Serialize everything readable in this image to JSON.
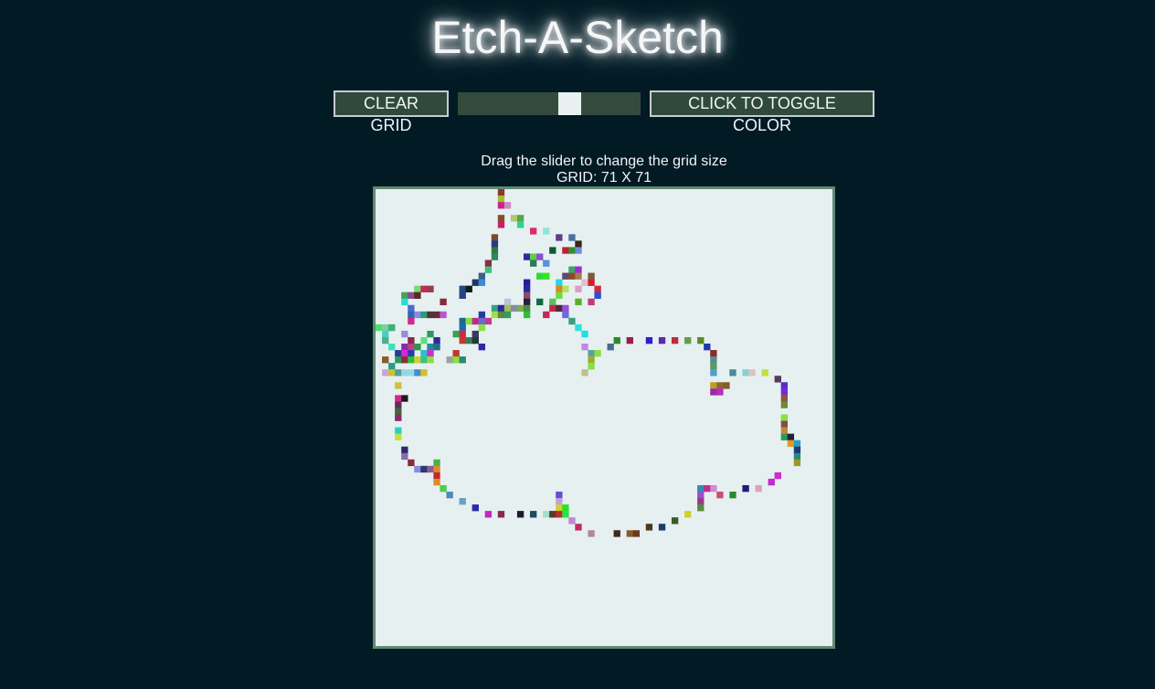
{
  "app": {
    "title": "Etch-A-Sketch"
  },
  "controls": {
    "clear_label": "CLEAR GRID",
    "toggle_label": "CLICK TO TOGGLE COLOR",
    "slider_value_fraction": 0.63
  },
  "info": {
    "hint": "Drag the slider to change the grid size",
    "grid_size": "GRID: 71 X 71"
  },
  "grid": {
    "columns": 71,
    "rows": 71,
    "background": "#e7f0f1",
    "painted_cells": [
      [
        19,
        0,
        "#8e3a2a"
      ],
      [
        19,
        1,
        "#a1c22d"
      ],
      [
        19,
        2,
        "#cc2287"
      ],
      [
        20,
        2,
        "#c88fc0"
      ],
      [
        19,
        4,
        "#8a4b2b"
      ],
      [
        21,
        4,
        "#b2c772"
      ],
      [
        22,
        4,
        "#5aa646"
      ],
      [
        19,
        5,
        "#cd1e6c"
      ],
      [
        22,
        5,
        "#2dd68d"
      ],
      [
        24,
        6,
        "#d8306e"
      ],
      [
        26,
        6,
        "#8fe6d6"
      ],
      [
        18,
        7,
        "#7a4a2c"
      ],
      [
        28,
        7,
        "#5e3f8a"
      ],
      [
        30,
        7,
        "#4f6fa1"
      ],
      [
        18,
        8,
        "#2a3a8a"
      ],
      [
        31,
        8,
        "#3c2514"
      ],
      [
        18,
        9,
        "#2c7a42"
      ],
      [
        27,
        9,
        "#0e5a2e"
      ],
      [
        29,
        9,
        "#c21d3c"
      ],
      [
        30,
        9,
        "#30902a"
      ],
      [
        31,
        9,
        "#6b8ad8"
      ],
      [
        18,
        10,
        "#2b8a55"
      ],
      [
        23,
        10,
        "#2d2aa3"
      ],
      [
        24,
        10,
        "#5fce4a"
      ],
      [
        25,
        10,
        "#8a4ed2"
      ],
      [
        17,
        11,
        "#8a2b47"
      ],
      [
        24,
        11,
        "#2e7a51"
      ],
      [
        26,
        11,
        "#5b8fe0"
      ],
      [
        17,
        12,
        "#3cbf7a"
      ],
      [
        30,
        12,
        "#3ca56b"
      ],
      [
        31,
        12,
        "#9a2bd8"
      ],
      [
        16,
        13,
        "#3a5f8a"
      ],
      [
        25,
        13,
        "#2ddb33"
      ],
      [
        26,
        13,
        "#33e51e"
      ],
      [
        29,
        13,
        "#5a4a6a"
      ],
      [
        30,
        13,
        "#8a4a2a"
      ],
      [
        31,
        13,
        "#a87a4e"
      ],
      [
        33,
        13,
        "#7a5a3b"
      ],
      [
        15,
        14,
        "#1e3a5f"
      ],
      [
        16,
        14,
        "#3a8ad2"
      ],
      [
        23,
        14,
        "#2a1a9a"
      ],
      [
        28,
        14,
        "#2ad6e3"
      ],
      [
        32,
        14,
        "#e0c0d0"
      ],
      [
        33,
        14,
        "#d21e2e"
      ],
      [
        6,
        15,
        "#6fe070"
      ],
      [
        7,
        15,
        "#c22a5a"
      ],
      [
        8,
        15,
        "#9a3b4a"
      ],
      [
        13,
        15,
        "#1f4a7a"
      ],
      [
        14,
        15,
        "#0e1a1e"
      ],
      [
        23,
        15,
        "#262a9a"
      ],
      [
        28,
        15,
        "#d68a1e"
      ],
      [
        29,
        15,
        "#b8e060"
      ],
      [
        31,
        15,
        "#d6a0c8"
      ],
      [
        34,
        15,
        "#d2283a"
      ],
      [
        4,
        16,
        "#4aa05a"
      ],
      [
        5,
        16,
        "#8a4e8e"
      ],
      [
        6,
        16,
        "#5a2a2a"
      ],
      [
        13,
        16,
        "#2a3e8a"
      ],
      [
        23,
        16,
        "#8a4e6a"
      ],
      [
        28,
        16,
        "#6adf3a"
      ],
      [
        34,
        16,
        "#2b4fd0"
      ],
      [
        4,
        17,
        "#1ee0d0"
      ],
      [
        10,
        17,
        "#8a2a3a"
      ],
      [
        20,
        17,
        "#c2c0d6"
      ],
      [
        23,
        17,
        "#2a1e3a"
      ],
      [
        25,
        17,
        "#0e6a3e"
      ],
      [
        27,
        17,
        "#5ac060"
      ],
      [
        31,
        17,
        "#5ab02a"
      ],
      [
        33,
        17,
        "#c23a7a"
      ],
      [
        5,
        18,
        "#4a6ad8"
      ],
      [
        18,
        18,
        "#3aa080"
      ],
      [
        19,
        18,
        "#2a2a9a"
      ],
      [
        20,
        18,
        "#a0c060"
      ],
      [
        21,
        18,
        "#8a8aa0"
      ],
      [
        22,
        18,
        "#7ab050"
      ],
      [
        23,
        18,
        "#4a8a4a"
      ],
      [
        27,
        18,
        "#c22a4a"
      ],
      [
        28,
        18,
        "#4a2a3a"
      ],
      [
        29,
        18,
        "#9a4ed0"
      ],
      [
        5,
        19,
        "#2a6aaa"
      ],
      [
        6,
        19,
        "#8a8ae0"
      ],
      [
        7,
        19,
        "#2a9a7a"
      ],
      [
        8,
        19,
        "#4a3a2a"
      ],
      [
        9,
        19,
        "#6a2a3a"
      ],
      [
        10,
        19,
        "#b25ad2"
      ],
      [
        16,
        19,
        "#2a3a9a"
      ],
      [
        18,
        19,
        "#a0e050"
      ],
      [
        19,
        19,
        "#5a8a3a"
      ],
      [
        20,
        19,
        "#3a9a5a"
      ],
      [
        23,
        19,
        "#2ac03a"
      ],
      [
        26,
        19,
        "#c22a5a"
      ],
      [
        29,
        19,
        "#6a6ae0"
      ],
      [
        5,
        20,
        "#d02a8a"
      ],
      [
        13,
        20,
        "#1e6a8a"
      ],
      [
        14,
        20,
        "#8ae040"
      ],
      [
        15,
        20,
        "#c22a8a"
      ],
      [
        16,
        20,
        "#6a6ad0"
      ],
      [
        17,
        20,
        "#c23a8a"
      ],
      [
        30,
        20,
        "#3aa07a"
      ],
      [
        0,
        21,
        "#4ae06a"
      ],
      [
        1,
        21,
        "#7ad0a0"
      ],
      [
        2,
        21,
        "#3ab07a"
      ],
      [
        13,
        21,
        "#1e6aaa"
      ],
      [
        16,
        21,
        "#8ae040"
      ],
      [
        31,
        21,
        "#2ae0e0"
      ],
      [
        1,
        22,
        "#4ad0c0"
      ],
      [
        4,
        22,
        "#9a8ae0"
      ],
      [
        8,
        22,
        "#2a9a5a"
      ],
      [
        12,
        22,
        "#3aa05a"
      ],
      [
        13,
        22,
        "#d22a3a"
      ],
      [
        15,
        22,
        "#3a3a5a"
      ],
      [
        32,
        22,
        "#1ee0e0"
      ],
      [
        1,
        23,
        "#4ab08a"
      ],
      [
        5,
        23,
        "#8a2a4a"
      ],
      [
        7,
        23,
        "#5ae080"
      ],
      [
        9,
        23,
        "#2a2a9a"
      ],
      [
        13,
        23,
        "#c23a2a"
      ],
      [
        14,
        23,
        "#3a7a5a"
      ],
      [
        15,
        23,
        "#1e3a3a"
      ],
      [
        37,
        23,
        "#2a8a2a"
      ],
      [
        39,
        23,
        "#9a1e4a"
      ],
      [
        42,
        23,
        "#2a1ed0"
      ],
      [
        44,
        23,
        "#5a2aaa"
      ],
      [
        46,
        23,
        "#c22a3a"
      ],
      [
        48,
        23,
        "#6a9a4a"
      ],
      [
        50,
        23,
        "#5a8a2a"
      ],
      [
        2,
        24,
        "#3ae0c0"
      ],
      [
        4,
        24,
        "#8a2aaa"
      ],
      [
        5,
        24,
        "#c23a8a"
      ],
      [
        6,
        24,
        "#2a9a3a"
      ],
      [
        8,
        24,
        "#1e8a9a"
      ],
      [
        9,
        24,
        "#2a6a8a"
      ],
      [
        16,
        24,
        "#2a2aaa"
      ],
      [
        32,
        24,
        "#c08ae0"
      ],
      [
        36,
        24,
        "#4a6a8a"
      ],
      [
        51,
        24,
        "#1e3aaa"
      ],
      [
        3,
        25,
        "#2a3a9a"
      ],
      [
        4,
        25,
        "#d62ad0"
      ],
      [
        5,
        25,
        "#2a3aaa"
      ],
      [
        7,
        25,
        "#2ac0d0"
      ],
      [
        8,
        25,
        "#d02ad0"
      ],
      [
        12,
        25,
        "#c23a2a"
      ],
      [
        33,
        25,
        "#5aa0a0"
      ],
      [
        34,
        25,
        "#8ae040"
      ],
      [
        52,
        25,
        "#8a2a2a"
      ],
      [
        1,
        26,
        "#8a5a2a"
      ],
      [
        3,
        26,
        "#2a9a5a"
      ],
      [
        4,
        26,
        "#8a2a3a"
      ],
      [
        5,
        26,
        "#2ac03a"
      ],
      [
        6,
        26,
        "#d0d02a"
      ],
      [
        7,
        26,
        "#3ac08a"
      ],
      [
        8,
        26,
        "#8ae040"
      ],
      [
        11,
        26,
        "#a0a0a0"
      ],
      [
        12,
        26,
        "#8ae040"
      ],
      [
        13,
        26,
        "#2a8a6a"
      ],
      [
        33,
        26,
        "#9ab02a"
      ],
      [
        52,
        26,
        "#5a8a8a"
      ],
      [
        2,
        27,
        "#2a9a8a"
      ],
      [
        33,
        27,
        "#8ae040"
      ],
      [
        52,
        27,
        "#5a9a6a"
      ],
      [
        1,
        28,
        "#d0a0e0"
      ],
      [
        2,
        28,
        "#d0c02a"
      ],
      [
        3,
        28,
        "#4aa0a0"
      ],
      [
        4,
        28,
        "#a0d0e0"
      ],
      [
        5,
        28,
        "#8ae0e0"
      ],
      [
        6,
        28,
        "#4a8ad0"
      ],
      [
        7,
        28,
        "#d0c02a"
      ],
      [
        32,
        28,
        "#c0c08a"
      ],
      [
        52,
        28,
        "#4aa0d0"
      ],
      [
        55,
        28,
        "#4a8a9a"
      ],
      [
        57,
        28,
        "#8ad0d0"
      ],
      [
        58,
        28,
        "#e0c0c0"
      ],
      [
        60,
        28,
        "#c0e040"
      ],
      [
        62,
        29,
        "#5a3a5a"
      ],
      [
        3,
        30,
        "#d0c040"
      ],
      [
        52,
        30,
        "#c09a2a"
      ],
      [
        53,
        30,
        "#8a6a2a"
      ],
      [
        54,
        30,
        "#8a5a2a"
      ],
      [
        63,
        30,
        "#5a2ad0"
      ],
      [
        52,
        31,
        "#9a2aaa"
      ],
      [
        53,
        31,
        "#c02ac0"
      ],
      [
        63,
        31,
        "#7a2ad0"
      ],
      [
        3,
        32,
        "#d02a8a"
      ],
      [
        4,
        32,
        "#1e1a1e"
      ],
      [
        63,
        32,
        "#8a5a3a"
      ],
      [
        3,
        33,
        "#6a2a5a"
      ],
      [
        63,
        33,
        "#6a8a3a"
      ],
      [
        3,
        34,
        "#3a6a3a"
      ],
      [
        3,
        35,
        "#8a2a6a"
      ],
      [
        63,
        35,
        "#8ae040"
      ],
      [
        63,
        36,
        "#8a4a4a"
      ],
      [
        3,
        37,
        "#2ad0c0"
      ],
      [
        63,
        37,
        "#c08a3a"
      ],
      [
        3,
        38,
        "#c0e040"
      ],
      [
        63,
        38,
        "#2a9a5a"
      ],
      [
        64,
        38,
        "#2a1e3a"
      ],
      [
        64,
        39,
        "#e09a2a"
      ],
      [
        65,
        39,
        "#2aa0c0"
      ],
      [
        4,
        40,
        "#2a2a6a"
      ],
      [
        65,
        40,
        "#1e3a7a"
      ],
      [
        4,
        41,
        "#8a6aaa"
      ],
      [
        65,
        41,
        "#2a8a7a"
      ],
      [
        5,
        42,
        "#8a2a3a"
      ],
      [
        9,
        42,
        "#4ab04a"
      ],
      [
        65,
        42,
        "#9a9a2a"
      ],
      [
        6,
        43,
        "#8a8ae0"
      ],
      [
        7,
        43,
        "#2a3a6a"
      ],
      [
        8,
        43,
        "#8a5a9a"
      ],
      [
        9,
        43,
        "#e08a2a"
      ],
      [
        9,
        44,
        "#c22a2a"
      ],
      [
        62,
        44,
        "#d02ad0"
      ],
      [
        9,
        45,
        "#e08a2a"
      ],
      [
        61,
        45,
        "#c02ad0"
      ],
      [
        10,
        46,
        "#4ad04a"
      ],
      [
        50,
        46,
        "#3a8aaa"
      ],
      [
        51,
        46,
        "#c22a8a"
      ],
      [
        52,
        46,
        "#d08ad0"
      ],
      [
        57,
        46,
        "#1e1a7a"
      ],
      [
        59,
        46,
        "#e0a0b0"
      ],
      [
        11,
        47,
        "#4a8ac0"
      ],
      [
        50,
        47,
        "#9a4ed0"
      ],
      [
        53,
        47,
        "#d04a7a"
      ],
      [
        55,
        47,
        "#2a8a2a"
      ],
      [
        28,
        47,
        "#6a4ad0"
      ],
      [
        13,
        48,
        "#6aa0c0"
      ],
      [
        28,
        48,
        "#c0a0e0"
      ],
      [
        50,
        48,
        "#9a3a8a"
      ],
      [
        15,
        49,
        "#2a2aaa"
      ],
      [
        28,
        49,
        "#d0d02a"
      ],
      [
        29,
        49,
        "#2ae02a"
      ],
      [
        50,
        49,
        "#5a8a3a"
      ],
      [
        17,
        50,
        "#c02ac0"
      ],
      [
        19,
        50,
        "#8a2a4a"
      ],
      [
        22,
        50,
        "#1e1a2a"
      ],
      [
        24,
        50,
        "#1e4a5a"
      ],
      [
        26,
        50,
        "#a0e0d0"
      ],
      [
        27,
        50,
        "#5a3a2a"
      ],
      [
        28,
        50,
        "#c02a2a"
      ],
      [
        29,
        50,
        "#2ae04a"
      ],
      [
        48,
        50,
        "#d0d02a"
      ],
      [
        30,
        51,
        "#c08ad0"
      ],
      [
        46,
        51,
        "#3a5a2a"
      ],
      [
        31,
        52,
        "#c22a6a"
      ],
      [
        42,
        52,
        "#4a3a1e"
      ],
      [
        44,
        52,
        "#1e3a6a"
      ],
      [
        33,
        53,
        "#b08a9a"
      ],
      [
        37,
        53,
        "#3a2a1e"
      ],
      [
        39,
        53,
        "#8a5a2a"
      ],
      [
        40,
        53,
        "#6a3a1e"
      ]
    ]
  }
}
